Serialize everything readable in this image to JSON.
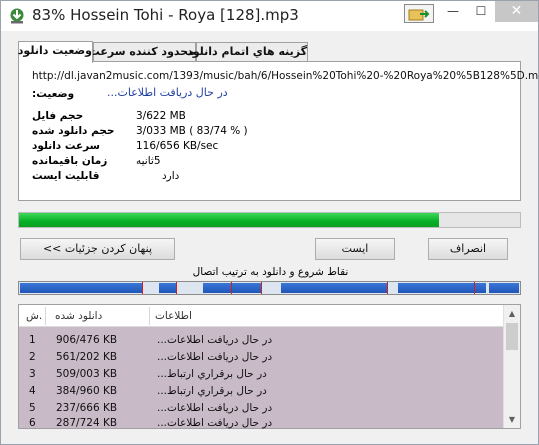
{
  "window": {
    "title": "83% Hossein Tohi - Roya [128].mp3",
    "controls": {
      "minimize": "—",
      "maximize": "☐",
      "close": "✕"
    }
  },
  "tabs": [
    {
      "label": "وضعیت دانلود",
      "active": true
    },
    {
      "label": "محدود کننده سرعت",
      "active": false
    },
    {
      "label": "گزینه هاي اتمام دانلود",
      "active": false
    }
  ],
  "details": {
    "url": "http://dl.javan2music.com/1393/music/bah/6/Hossein%20Tohi%20-%20Roya%20%5B128%5D.mp3",
    "status_label": "وضعیت:",
    "status_value": "در حال دریافت اطلاعات...",
    "rows": [
      {
        "label": "حجم فایل",
        "value": "3/622  MB"
      },
      {
        "label": "حجم دانلود شده",
        "value": "3/033  MB  ( 83/74 % )"
      },
      {
        "label": "سرعت دانلود",
        "value": "116/656  KB/sec"
      },
      {
        "label": "زمان باقیمانده",
        "value": "5ثانیه"
      },
      {
        "label": "قابلیت ایست",
        "value": "دارد"
      }
    ]
  },
  "progress": {
    "percent": 83.74
  },
  "buttons": {
    "details": "پنهان کردن جزئیات >>",
    "pause": "ایست",
    "cancel": "انصراف"
  },
  "segments": {
    "caption": "نقاط شروع و دانلود به ترتیب اتصال"
  },
  "table": {
    "columns": [
      "ش.",
      "دانلود شده",
      "اطلاعات"
    ],
    "rows": [
      {
        "n": "1",
        "downloaded": "906/476  KB",
        "info": "در حال دریافت اطلاعات..."
      },
      {
        "n": "2",
        "downloaded": "561/202  KB",
        "info": "در حال دریافت اطلاعات..."
      },
      {
        "n": "3",
        "downloaded": "509/003  KB",
        "info": "در حال برقراري ارتباط..."
      },
      {
        "n": "4",
        "downloaded": "384/960  KB",
        "info": "در حال برقراري ارتباط..."
      },
      {
        "n": "5",
        "downloaded": "237/666  KB",
        "info": "در حال دریافت اطلاعات..."
      },
      {
        "n": "6",
        "downloaded": "287/724  KB",
        "info": "در حال دریافت اطلاعات..."
      }
    ]
  }
}
